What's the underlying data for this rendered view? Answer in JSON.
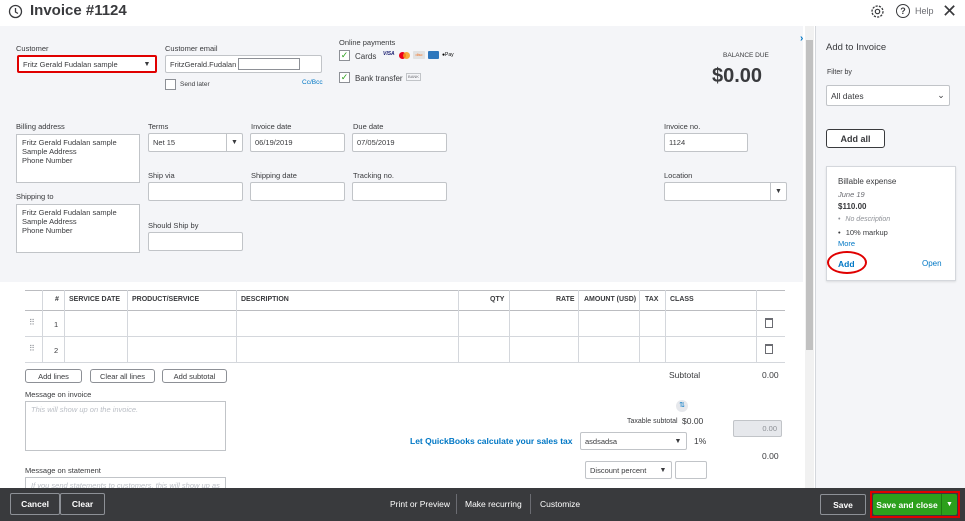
{
  "header": {
    "title": "Invoice #1124",
    "help": "Help"
  },
  "customer": {
    "label": "Customer",
    "value": "Fritz Gerald Fudalan sample"
  },
  "email": {
    "label": "Customer email",
    "value": "FritzGerald.Fudalan",
    "send_later": "Send later",
    "ccbcc": "Cc/Bcc"
  },
  "payments": {
    "label": "Online payments",
    "cards": "Cards",
    "bank": "Bank transfer",
    "bank_badge": "BANK"
  },
  "balance": {
    "label": "BALANCE DUE",
    "amount": "$0.00"
  },
  "billing": {
    "label": "Billing address",
    "lines": "Fritz Gerald Fudalan sample\nSample Address\nPhone Number"
  },
  "shipping": {
    "label": "Shipping to",
    "lines": "Fritz Gerald Fudalan sample\nSample Address\nPhone Number"
  },
  "terms": {
    "label": "Terms",
    "value": "Net 15"
  },
  "invoice_date": {
    "label": "Invoice date",
    "value": "06/19/2019"
  },
  "due_date": {
    "label": "Due date",
    "value": "07/05/2019"
  },
  "invoice_no": {
    "label": "Invoice no.",
    "value": "1124"
  },
  "ship_via": {
    "label": "Ship via"
  },
  "shipping_date": {
    "label": "Shipping date"
  },
  "tracking": {
    "label": "Tracking no."
  },
  "location": {
    "label": "Location"
  },
  "should_ship": {
    "label": "Should Ship by"
  },
  "table": {
    "headers": [
      "#",
      "SERVICE DATE",
      "PRODUCT/SERVICE",
      "DESCRIPTION",
      "QTY",
      "RATE",
      "AMOUNT (USD)",
      "TAX",
      "CLASS"
    ],
    "rows": [
      "1",
      "2"
    ]
  },
  "buttons": {
    "add_lines": "Add lines",
    "clear_lines": "Clear all lines",
    "add_subtotal": "Add subtotal"
  },
  "totals": {
    "subtotal_label": "Subtotal",
    "subtotal": "0.00",
    "taxable_label": "Taxable subtotal",
    "taxable": "$0.00",
    "tax_link": "Let QuickBooks calculate your sales tax",
    "tax_select": "asdsadsa",
    "tax_rate": "1%",
    "tax_amount": "0.00",
    "total2": "0.00",
    "discount": "Discount percent"
  },
  "message_invoice": {
    "label": "Message on invoice",
    "placeholder": "This will show up on the invoice."
  },
  "message_statement": {
    "label": "Message on statement",
    "placeholder": "If you send statements to customers, this will show up as"
  },
  "panel": {
    "title": "Add to Invoice",
    "filter_label": "Filter by",
    "filter_value": "All dates",
    "add_all": "Add all",
    "card": {
      "title": "Billable expense",
      "date": "June 19",
      "amount": "$110.00",
      "desc": "No description",
      "markup": "10% markup",
      "more": "More",
      "add": "Add",
      "open": "Open"
    }
  },
  "footer": {
    "cancel": "Cancel",
    "clear": "Clear",
    "print": "Print or Preview",
    "recurring": "Make recurring",
    "customize": "Customize",
    "save": "Save",
    "save_close": "Save and close"
  },
  "colors": {
    "green": "#2ca01c",
    "link": "#0077c5",
    "footer": "#393a3d",
    "highlight": "#e00000"
  }
}
